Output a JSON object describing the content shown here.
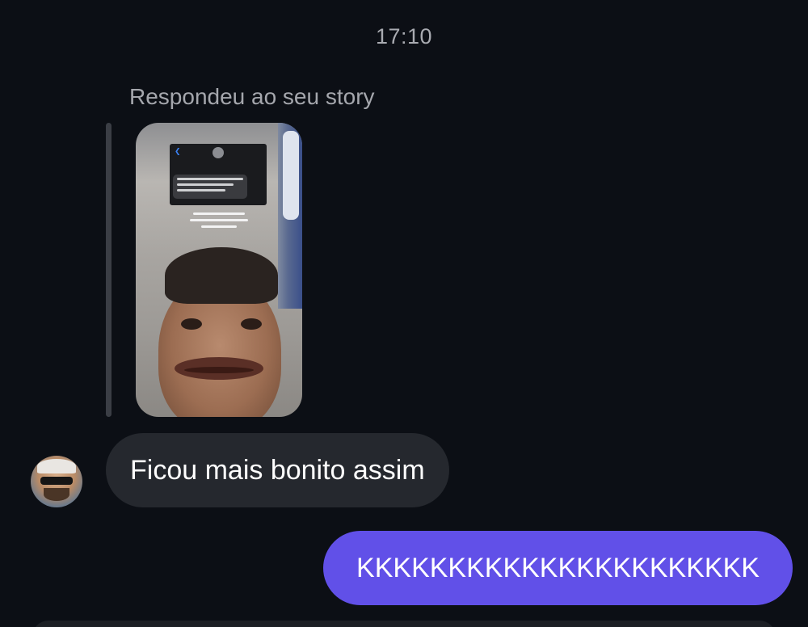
{
  "chat": {
    "timestamp": "17:10",
    "reply_caption": "Respondeu ao seu story",
    "incoming_message": "Ficou mais bonito assim",
    "outgoing_message": "KKKKKKKKKKKKKKKKKKKKKK"
  },
  "colors": {
    "background": "#0c0f15",
    "incoming_bubble": "#25282e",
    "outgoing_bubble": "#6150e8",
    "muted_text": "#a9abb1"
  },
  "icons": {
    "avatar": "sender-avatar",
    "story": "story-thumbnail"
  }
}
